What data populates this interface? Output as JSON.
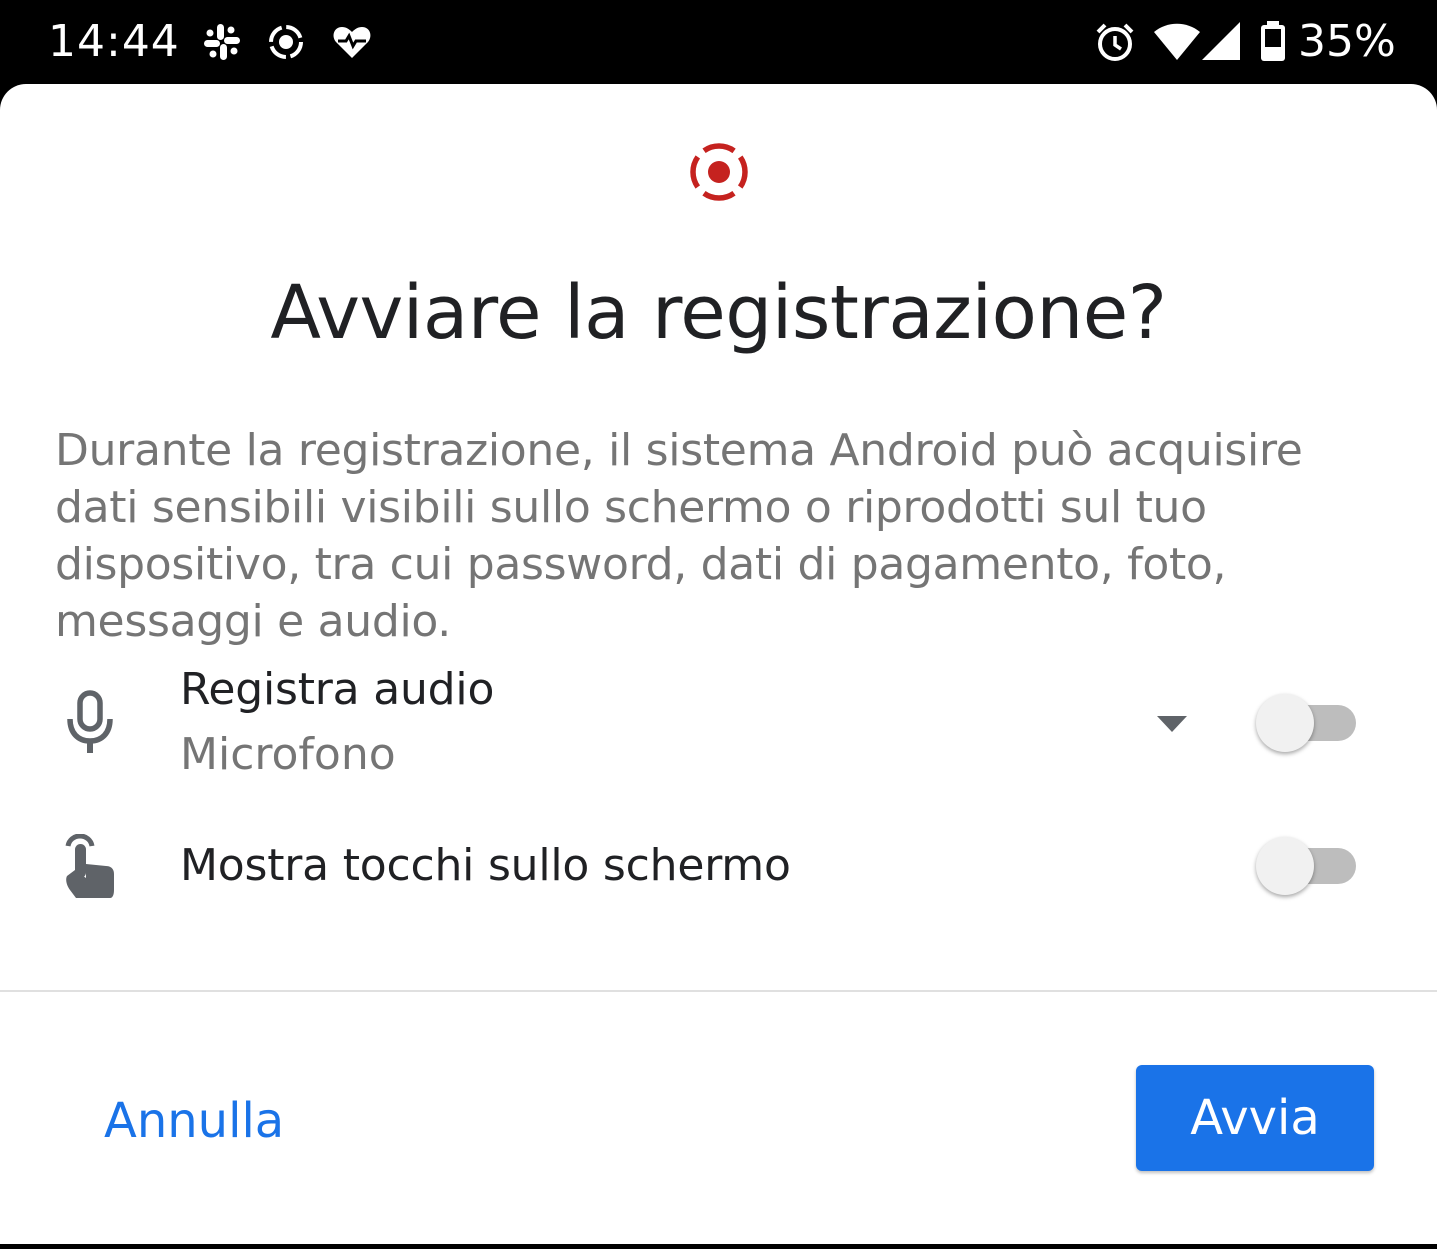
{
  "status_bar": {
    "time": "14:44",
    "battery_percent": "35%",
    "left_icons": [
      "slack-icon",
      "screen-record-icon",
      "health-heart-icon"
    ],
    "right_icons": [
      "alarm-icon",
      "wifi-icon",
      "cell-signal-icon",
      "battery-icon"
    ]
  },
  "dialog": {
    "icon": "screen-record-icon",
    "accent_color": "#c5221f",
    "title": "Avviare la registrazione?",
    "description": "Durante la registrazione, il sistema Android può acquisire dati sensibili visibili sullo schermo o riprodotti sul tuo dispositivo, tra cui password, dati di pagamento, foto, messaggi e audio.",
    "options": [
      {
        "icon": "microphone-icon",
        "label": "Registra audio",
        "sublabel": "Microfono",
        "has_dropdown": true,
        "enabled": false
      },
      {
        "icon": "touch-hand-icon",
        "label": "Mostra tocchi sullo schermo",
        "enabled": false
      }
    ],
    "buttons": {
      "cancel": "Annulla",
      "start": "Avvia",
      "primary_color": "#1a73e8"
    }
  }
}
